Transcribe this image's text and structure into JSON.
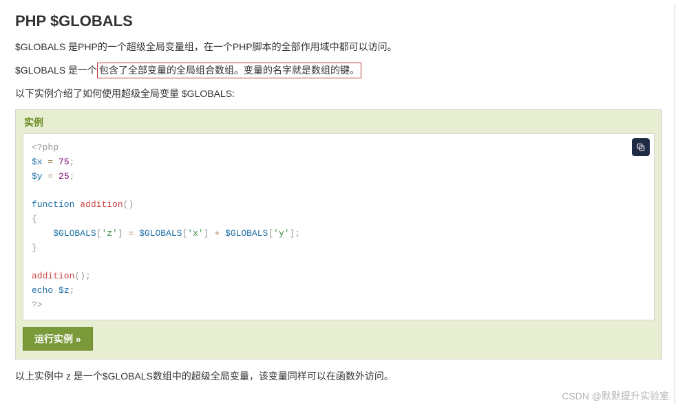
{
  "title": "PHP $GLOBALS",
  "para1": "$GLOBALS 是PHP的一个超级全局变量组，在一个PHP脚本的全部作用域中都可以访问。",
  "para2_a": "$GLOBALS 是一个",
  "para2_box": "包含了全部变量的全局组合数组。变量的名字就是数组的键。",
  "para3": "以下实例介绍了如何使用超级全局变量 $GLOBALS:",
  "exampleHeader": "实例",
  "code": {
    "l1_open": "<?php",
    "l2_var": "$x",
    "l2_eq": " = ",
    "l2_num": "75",
    "l2_semi": ";",
    "l3_var": "$y",
    "l3_eq": " = ",
    "l3_num": "25",
    "l3_semi": ";",
    "l5_kw": "function",
    "l5_sp": " ",
    "l5_fn": "addition",
    "l5_par": "()",
    "l6_br": "{",
    "l7_indent": "    ",
    "l7_g1": "$GLOBALS",
    "l7_b1o": "[",
    "l7_s1": "'z'",
    "l7_b1c": "]",
    "l7_eq": " = ",
    "l7_g2": "$GLOBALS",
    "l7_b2o": "[",
    "l7_s2": "'x'",
    "l7_b2c": "]",
    "l7_plus": " + ",
    "l7_g3": "$GLOBALS",
    "l7_b3o": "[",
    "l7_s3": "'y'",
    "l7_b3c": "]",
    "l7_semi": ";",
    "l8_br": "}",
    "l10_fn": "addition",
    "l10_par": "();",
    "l11_kw": "echo",
    "l11_sp": " ",
    "l11_var": "$z",
    "l11_semi": ";",
    "l12_close": "?>"
  },
  "runLabel": "运行实例 »",
  "para4": "以上实例中 z 是一个$GLOBALS数组中的超级全局变量，该变量同样可以在函数外访问。",
  "watermark": "CSDN @默默提升实验室"
}
